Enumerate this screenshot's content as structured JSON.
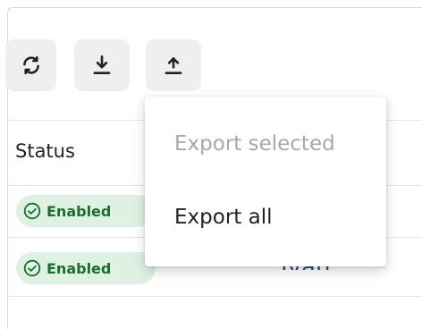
{
  "toolbar": {
    "refresh_icon": "refresh-icon",
    "download_icon": "download-icon",
    "upload_icon": "upload-icon"
  },
  "table": {
    "columns": {
      "status": "Status"
    },
    "rows": [
      {
        "status": "Enabled",
        "name": ""
      },
      {
        "status": "Enabled",
        "name": "Ivan"
      }
    ]
  },
  "export_menu": {
    "items": [
      {
        "label": "Export selected",
        "disabled": true
      },
      {
        "label": "Export all",
        "disabled": false
      }
    ]
  },
  "colors": {
    "status_enabled_bg": "#dff1e3",
    "status_enabled_text": "#1a6f2b",
    "link": "#2b4a8a",
    "toolbar_button_bg": "#efefef"
  }
}
